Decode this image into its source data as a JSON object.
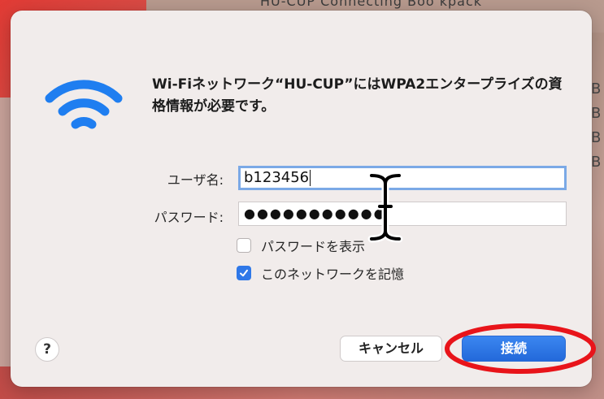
{
  "background": {
    "top_text": "HU-CUP Connecting Boo kpack",
    "right_text": "B B B B"
  },
  "dialog": {
    "icon": "wifi-icon",
    "message": "Wi-Fiネットワーク“HU-CUP”にはWPA2エンタープライズの資格情報が必要です。",
    "username": {
      "label": "ユーザ名:",
      "value": "b123456"
    },
    "password": {
      "label": "パスワード:",
      "masked_value": "●●●●●●●●●●●"
    },
    "show_password": {
      "label": "パスワードを表示",
      "checked": false
    },
    "remember_network": {
      "label": "このネットワークを記憶",
      "checked": true
    },
    "help_label": "?",
    "cancel_label": "キャンセル",
    "connect_label": "接続"
  },
  "colors": {
    "accent": "#2f78e8",
    "highlight_annotation": "#e8141a",
    "wifi_icon": "#1f7ef0"
  }
}
